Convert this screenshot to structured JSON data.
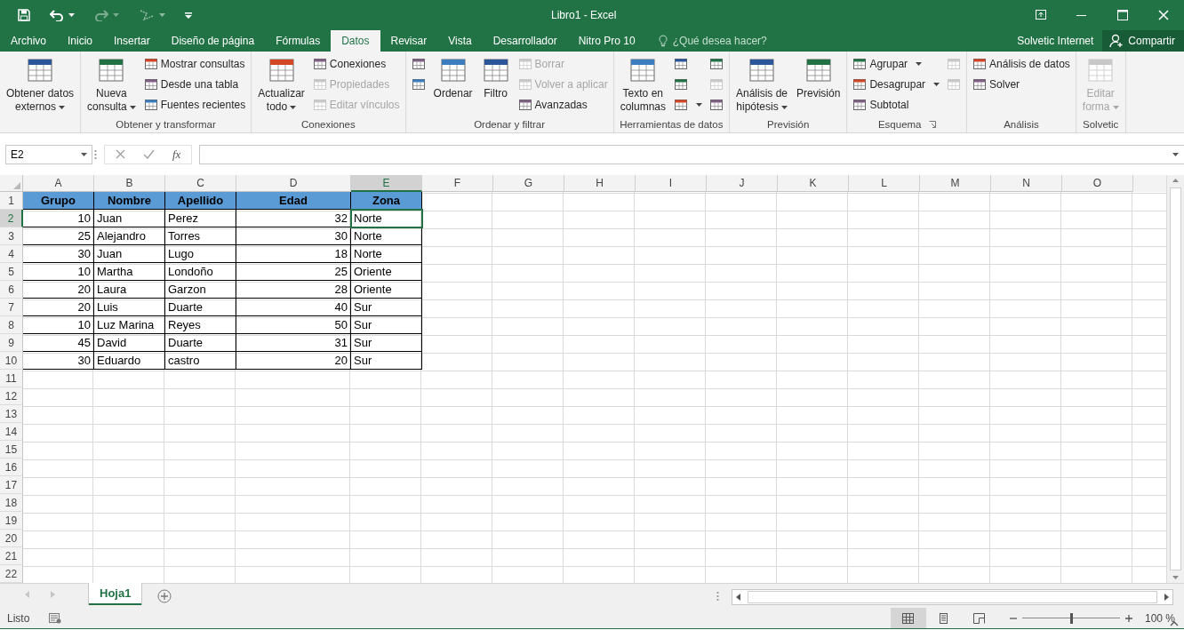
{
  "window": {
    "title": "Libro1 - Excel"
  },
  "ribbon_tabs": [
    {
      "label": "Archivo",
      "selected": false
    },
    {
      "label": "Inicio",
      "selected": false
    },
    {
      "label": "Insertar",
      "selected": false
    },
    {
      "label": "Diseño de página",
      "selected": false
    },
    {
      "label": "Fórmulas",
      "selected": false
    },
    {
      "label": "Datos",
      "selected": true
    },
    {
      "label": "Revisar",
      "selected": false
    },
    {
      "label": "Vista",
      "selected": false
    },
    {
      "label": "Desarrollador",
      "selected": false
    },
    {
      "label": "Nitro Pro 10",
      "selected": false
    }
  ],
  "tell_me": {
    "placeholder": "¿Qué desea hacer?"
  },
  "user": "Solvetic Internet",
  "share_button": "Compartir",
  "ribbon_groups": [
    {
      "columns": [
        {
          "kind": "large",
          "lines": [
            "Obtener datos",
            "externos"
          ],
          "dropdown": true,
          "disabled": false
        }
      ]
    },
    {
      "label": "Obtener y transformar",
      "columns": [
        {
          "kind": "large",
          "lines": [
            "Nueva",
            "consulta"
          ],
          "dropdown": true,
          "disabled": false
        },
        {
          "kind": "stack",
          "items": [
            {
              "label": "Mostrar consultas",
              "disabled": false,
              "dropdown": false
            },
            {
              "label": "Desde una tabla",
              "disabled": false,
              "dropdown": false
            },
            {
              "label": "Fuentes recientes",
              "disabled": false,
              "dropdown": false
            }
          ]
        }
      ]
    },
    {
      "label": "Conexiones",
      "columns": [
        {
          "kind": "large",
          "lines": [
            "Actualizar",
            "todo"
          ],
          "dropdown": true,
          "disabled": false
        },
        {
          "kind": "stack",
          "items": [
            {
              "label": "Conexiones",
              "disabled": false,
              "dropdown": false
            },
            {
              "label": "Propiedades",
              "disabled": true,
              "dropdown": false
            },
            {
              "label": "Editar vínculos",
              "disabled": true,
              "dropdown": false
            }
          ]
        }
      ]
    },
    {
      "label": "Ordenar y filtrar",
      "columns": [
        {
          "kind": "stack",
          "items": [
            {
              "disabled": false,
              "dropdown": false
            },
            {
              "disabled": false,
              "dropdown": false
            }
          ]
        },
        {
          "kind": "large",
          "lines": [
            "Ordenar"
          ],
          "dropdown": false,
          "disabled": false
        },
        {
          "kind": "large",
          "lines": [
            "Filtro"
          ],
          "dropdown": false,
          "disabled": false
        },
        {
          "kind": "stack",
          "items": [
            {
              "label": "Borrar",
              "disabled": true,
              "dropdown": false
            },
            {
              "label": "Volver a aplicar",
              "disabled": true,
              "dropdown": false
            },
            {
              "label": "Avanzadas",
              "disabled": false,
              "dropdown": false
            }
          ]
        }
      ]
    },
    {
      "label": "Herramientas de datos",
      "columns": [
        {
          "kind": "large",
          "lines": [
            "Texto en",
            "columnas"
          ],
          "dropdown": false,
          "disabled": false
        },
        {
          "kind": "stack",
          "items": [
            {
              "disabled": false,
              "dropdown": false
            },
            {
              "disabled": false,
              "dropdown": false
            },
            {
              "disabled": false,
              "dropdown": true
            }
          ]
        },
        {
          "kind": "stack",
          "items": [
            {
              "disabled": false,
              "dropdown": false
            },
            {
              "disabled": true,
              "dropdown": false
            },
            {
              "disabled": false,
              "dropdown": false
            }
          ]
        }
      ]
    },
    {
      "label": "Previsión",
      "columns": [
        {
          "kind": "large",
          "lines": [
            "Análisis de",
            "hipótesis"
          ],
          "dropdown": true,
          "disabled": false
        },
        {
          "kind": "large",
          "lines": [
            "Previsión"
          ],
          "dropdown": false,
          "disabled": false
        }
      ]
    },
    {
      "label": "Esquema",
      "launcher": true,
      "columns": [
        {
          "kind": "stack",
          "items": [
            {
              "label": "Agrupar",
              "disabled": false,
              "dropdown": true
            },
            {
              "label": "Desagrupar",
              "disabled": false,
              "dropdown": true
            },
            {
              "label": "Subtotal",
              "disabled": false,
              "dropdown": false
            }
          ]
        },
        {
          "kind": "stack",
          "items": [
            {
              "disabled": true,
              "dropdown": false
            },
            {
              "disabled": true,
              "dropdown": false
            }
          ]
        }
      ]
    },
    {
      "label": "Análisis",
      "columns": [
        {
          "kind": "stack",
          "items": [
            {
              "label": "Análisis de datos",
              "disabled": false,
              "dropdown": false
            },
            {
              "label": "Solver",
              "disabled": false,
              "dropdown": false
            }
          ]
        }
      ]
    },
    {
      "label": "Solvetic",
      "columns": [
        {
          "kind": "large",
          "lines": [
            "Editar",
            "forma"
          ],
          "dropdown": true,
          "disabled": true
        }
      ]
    }
  ],
  "formula_bar": {
    "name_box": "E2",
    "function_label": "fx"
  },
  "sheet": {
    "columns": [
      {
        "label": "A",
        "selected": false
      },
      {
        "label": "B",
        "selected": false
      },
      {
        "label": "C",
        "selected": false
      },
      {
        "label": "D",
        "selected": false
      },
      {
        "label": "E",
        "selected": true
      },
      {
        "label": "F",
        "selected": false
      },
      {
        "label": "G",
        "selected": false
      },
      {
        "label": "H",
        "selected": false
      },
      {
        "label": "I",
        "selected": false
      },
      {
        "label": "J",
        "selected": false
      },
      {
        "label": "K",
        "selected": false
      },
      {
        "label": "L",
        "selected": false
      },
      {
        "label": "M",
        "selected": false
      },
      {
        "label": "N",
        "selected": false
      },
      {
        "label": "O",
        "selected": false
      }
    ],
    "rows": [
      {
        "number": "1",
        "selected": false,
        "kind": "header",
        "cells": [
          "Grupo",
          "Nombre",
          "Apellido",
          "Edad",
          "Zona"
        ]
      },
      {
        "number": "2",
        "selected": true,
        "kind": "data",
        "cells": [
          "10",
          "Juan",
          "Perez",
          "32",
          "Norte"
        ]
      },
      {
        "number": "3",
        "selected": false,
        "kind": "data",
        "cells": [
          "25",
          "Alejandro",
          "Torres",
          "30",
          "Norte"
        ]
      },
      {
        "number": "4",
        "selected": false,
        "kind": "data",
        "cells": [
          "30",
          "Juan",
          "Lugo",
          "18",
          "Norte"
        ]
      },
      {
        "number": "5",
        "selected": false,
        "kind": "data",
        "cells": [
          "10",
          "Martha",
          "Londoño",
          "25",
          "Oriente"
        ]
      },
      {
        "number": "6",
        "selected": false,
        "kind": "data",
        "cells": [
          "20",
          "Laura",
          "Garzon",
          "28",
          "Oriente"
        ]
      },
      {
        "number": "7",
        "selected": false,
        "kind": "data",
        "cells": [
          "20",
          "Luis",
          "Duarte",
          "40",
          "Sur"
        ]
      },
      {
        "number": "8",
        "selected": false,
        "kind": "data",
        "cells": [
          "10",
          "Luz Marina",
          "Reyes",
          "50",
          "Sur"
        ]
      },
      {
        "number": "9",
        "selected": false,
        "kind": "data",
        "cells": [
          "45",
          "David",
          "Duarte",
          "31",
          "Sur"
        ]
      },
      {
        "number": "10",
        "selected": false,
        "kind": "data",
        "cells": [
          "30",
          "Eduardo",
          "castro",
          "20",
          "Sur"
        ]
      },
      {
        "number": "11",
        "selected": false,
        "kind": "empty"
      },
      {
        "number": "12",
        "selected": false,
        "kind": "empty"
      },
      {
        "number": "13",
        "selected": false,
        "kind": "empty"
      },
      {
        "number": "14",
        "selected": false,
        "kind": "empty"
      },
      {
        "number": "15",
        "selected": false,
        "kind": "empty"
      },
      {
        "number": "16",
        "selected": false,
        "kind": "empty"
      },
      {
        "number": "17",
        "selected": false,
        "kind": "empty"
      },
      {
        "number": "18",
        "selected": false,
        "kind": "empty"
      },
      {
        "number": "19",
        "selected": false,
        "kind": "empty"
      },
      {
        "number": "20",
        "selected": false,
        "kind": "empty"
      },
      {
        "number": "21",
        "selected": false,
        "kind": "empty"
      },
      {
        "number": "22",
        "selected": false,
        "kind": "empty"
      }
    ]
  },
  "sheet_tabs": [
    {
      "label": "Hoja1",
      "selected": true
    }
  ],
  "status_bar": {
    "status": "Listo",
    "views": [
      {
        "selected": true
      },
      {
        "selected": false
      },
      {
        "selected": false
      }
    ],
    "zoom": {
      "level": 0.5,
      "reading": "100 %"
    }
  }
}
